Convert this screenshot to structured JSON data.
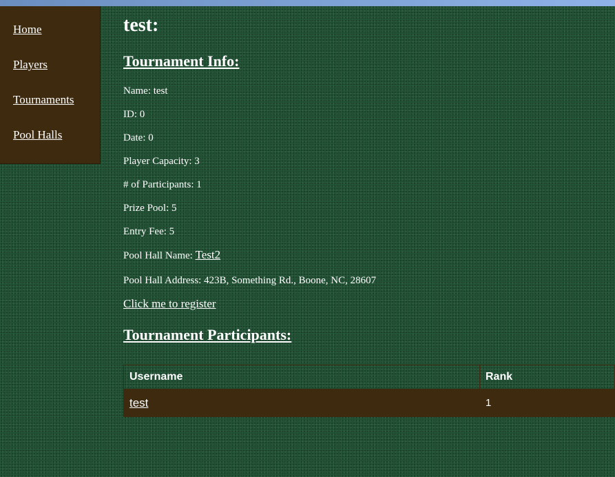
{
  "nav": {
    "items": [
      {
        "label": "Home"
      },
      {
        "label": "Players"
      },
      {
        "label": "Tournaments"
      },
      {
        "label": "Pool Halls"
      }
    ]
  },
  "page": {
    "title": "test:"
  },
  "info": {
    "heading": "Tournament Info:",
    "name": "Name: test",
    "id": "ID: 0",
    "date": "Date: 0",
    "capacity": "Player Capacity: 3",
    "participants_count": "# of Participants: 1",
    "prize_pool": "Prize Pool: 5",
    "entry_fee": "Entry Fee: 5",
    "pool_hall_name_label": "Pool Hall Name: ",
    "pool_hall_name_link": "Test2",
    "pool_hall_address": "Pool Hall Address: 423B, Something Rd., Boone, NC, 28607",
    "register_link": "Click me to register"
  },
  "participants": {
    "heading": "Tournament Participants:",
    "columns": [
      "Username",
      "Rank"
    ],
    "rows": [
      {
        "username": "test",
        "rank": "1"
      }
    ]
  },
  "colors": {
    "felt_green": "#255a3a",
    "panel_brown": "#3d2a0f",
    "top_strip": "#8fb2e8"
  }
}
